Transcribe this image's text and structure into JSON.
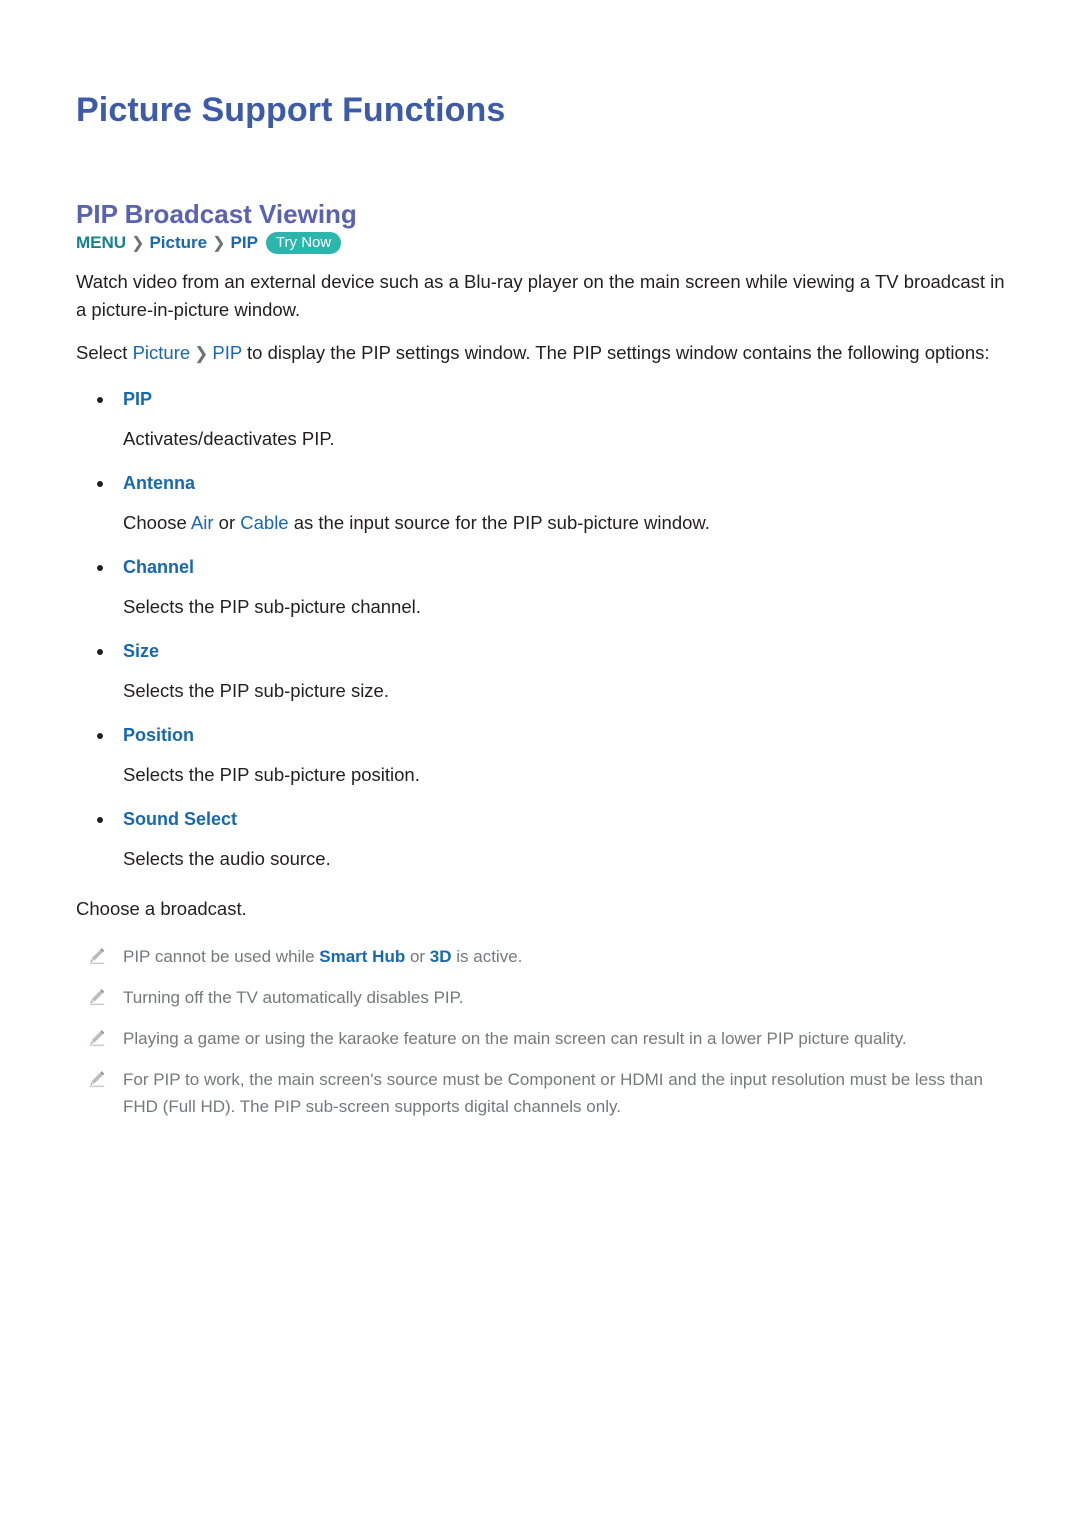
{
  "page": {
    "title": "Picture Support Functions",
    "section_title": "PIP Broadcast Viewing"
  },
  "breadcrumb": {
    "root": "MENU",
    "separator": "❯",
    "items": [
      "Picture",
      "PIP"
    ],
    "badge": "Try Now"
  },
  "intro": {
    "paragraph1": "Watch video from an external device such as a Blu-ray player on the main screen while viewing a TV broadcast in a picture-in-picture window.",
    "p2_prefix": "Select ",
    "p2_link1": "Picture",
    "p2_link2": "PIP",
    "p2_suffix": " to display the PIP settings window. The PIP settings window contains the following options:"
  },
  "options": [
    {
      "name": "PIP",
      "desc": "Activates/deactivates PIP."
    },
    {
      "name": "Antenna",
      "desc_prefix": "Choose ",
      "desc_link1": "Air",
      "desc_mid": " or ",
      "desc_link2": "Cable",
      "desc_suffix": " as the input source for the PIP sub-picture window."
    },
    {
      "name": "Channel",
      "desc": "Selects the PIP sub-picture channel."
    },
    {
      "name": "Size",
      "desc": "Selects the PIP sub-picture size."
    },
    {
      "name": "Position",
      "desc": "Selects the PIP sub-picture position."
    },
    {
      "name": "Sound Select",
      "desc": "Selects the audio source."
    }
  ],
  "closing_line": "Choose a broadcast.",
  "notes": [
    {
      "prefix": "PIP cannot be used while ",
      "link1": "Smart Hub",
      "mid": " or ",
      "link2": "3D",
      "suffix": " is active."
    },
    {
      "text": "Turning off the TV automatically disables PIP."
    },
    {
      "text": "Playing a game or using the karaoke feature on the main screen can result in a lower PIP picture quality."
    },
    {
      "text": "For PIP to work, the main screen's source must be Component or HDMI and the input resolution must be less than FHD (Full HD). The PIP sub-screen supports digital channels only."
    }
  ],
  "colors": {
    "title_blue": "#3e5ba9",
    "section_purple": "#5a62b4",
    "teal": "#17838f",
    "badge_teal": "#2bb6ad",
    "link_blue": "#1668b0",
    "body_black": "#231f20",
    "note_gray": "#76787b"
  }
}
